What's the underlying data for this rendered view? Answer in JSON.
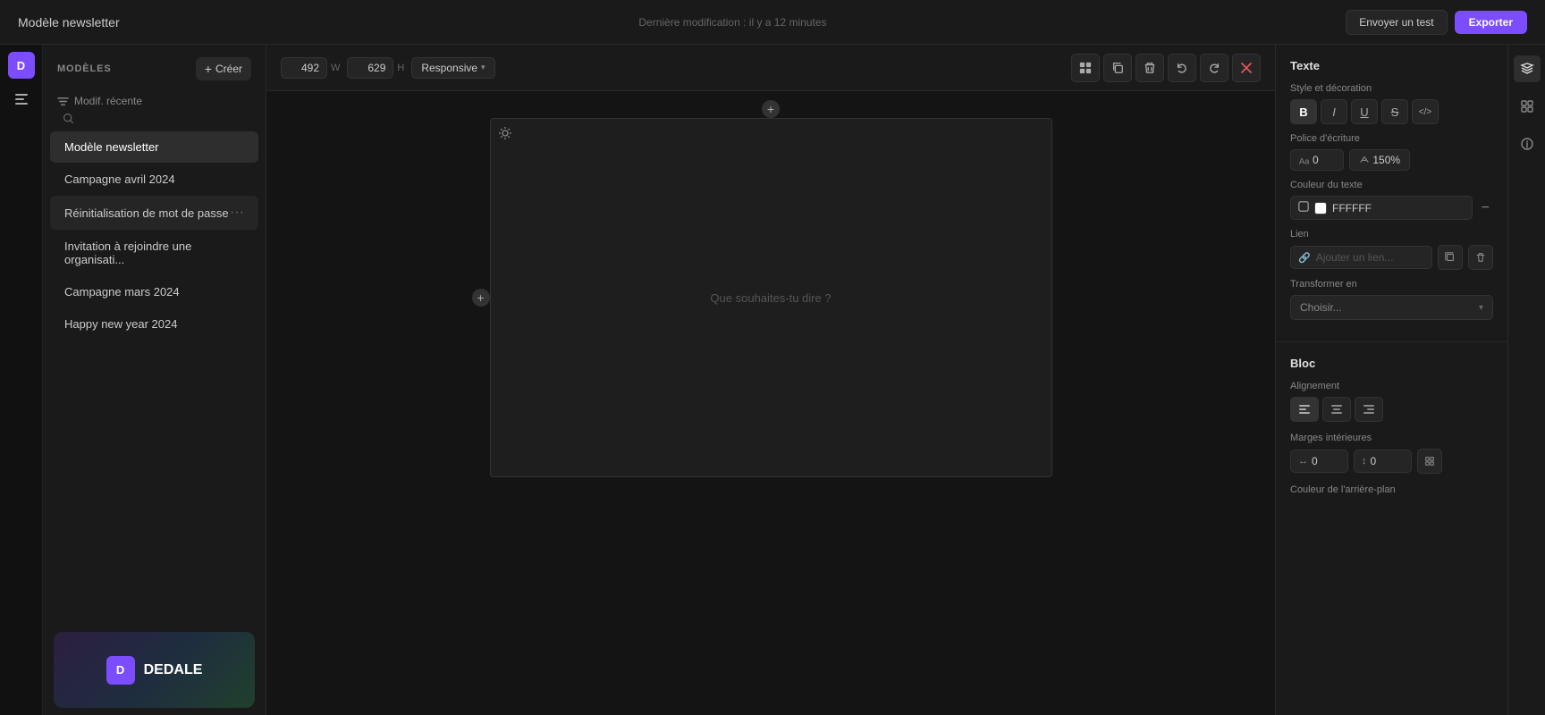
{
  "app": {
    "title": "Modèle newsletter"
  },
  "icon_rail": {
    "avatar_label": "D"
  },
  "sidebar": {
    "header": "MODÈLES",
    "create_btn": "Créer",
    "sort_label": "Modif. récente",
    "items": [
      {
        "id": "modele-newsletter",
        "label": "Modèle newsletter",
        "active": true
      },
      {
        "id": "campagne-avril",
        "label": "Campagne avril 2024",
        "active": false
      },
      {
        "id": "reinitialisation",
        "label": "Réinitialisation de mot de passe",
        "active": false,
        "dots": "···"
      },
      {
        "id": "invitation",
        "label": "Invitation à rejoindre une organisati...",
        "active": false
      },
      {
        "id": "campagne-mars",
        "label": "Campagne mars 2024",
        "active": false
      },
      {
        "id": "happy-new-year",
        "label": "Happy new year 2024",
        "active": false
      }
    ],
    "preview_logo": "D",
    "preview_name": "DEDALE"
  },
  "editor": {
    "title": "Modèle newsletter",
    "last_modified_label": "Dernière modification :",
    "last_modified_value": "il y a 12 minutes",
    "send_test_btn": "Envoyer un test",
    "export_btn": "Exporter",
    "width": "492",
    "width_unit": "W",
    "height": "629",
    "height_unit": "H",
    "responsive_label": "Responsive",
    "canvas_placeholder": "Que souhaites-tu dire ?"
  },
  "right_panel": {
    "text_section_title": "Texte",
    "style_decoration_label": "Style et décoration",
    "bold_icon": "B",
    "italic_icon": "I",
    "underline_icon": "U",
    "strikethrough_icon": "S",
    "code_icon": "</>",
    "font_label": "Police d'écriture",
    "font_size": "0",
    "font_scale": "150%",
    "color_label": "Couleur du texte",
    "color_value": "FFFFFF",
    "link_label": "Lien",
    "link_placeholder": "Ajouter un lien...",
    "transform_label": "Transformer en",
    "transform_placeholder": "Choisir...",
    "bloc_title": "Bloc",
    "alignment_label": "Alignement",
    "align_left_icon": "≡",
    "align_center_icon": "≡",
    "align_right_icon": "≡",
    "margins_label": "Marges intérieures",
    "margin_h_value": "0",
    "margin_v_value": "0",
    "bg_color_label": "Couleur de l'arrière-plan"
  },
  "far_right_icons": {
    "layers_icon": "layers",
    "blocks_icon": "blocks",
    "info_icon": "info"
  }
}
